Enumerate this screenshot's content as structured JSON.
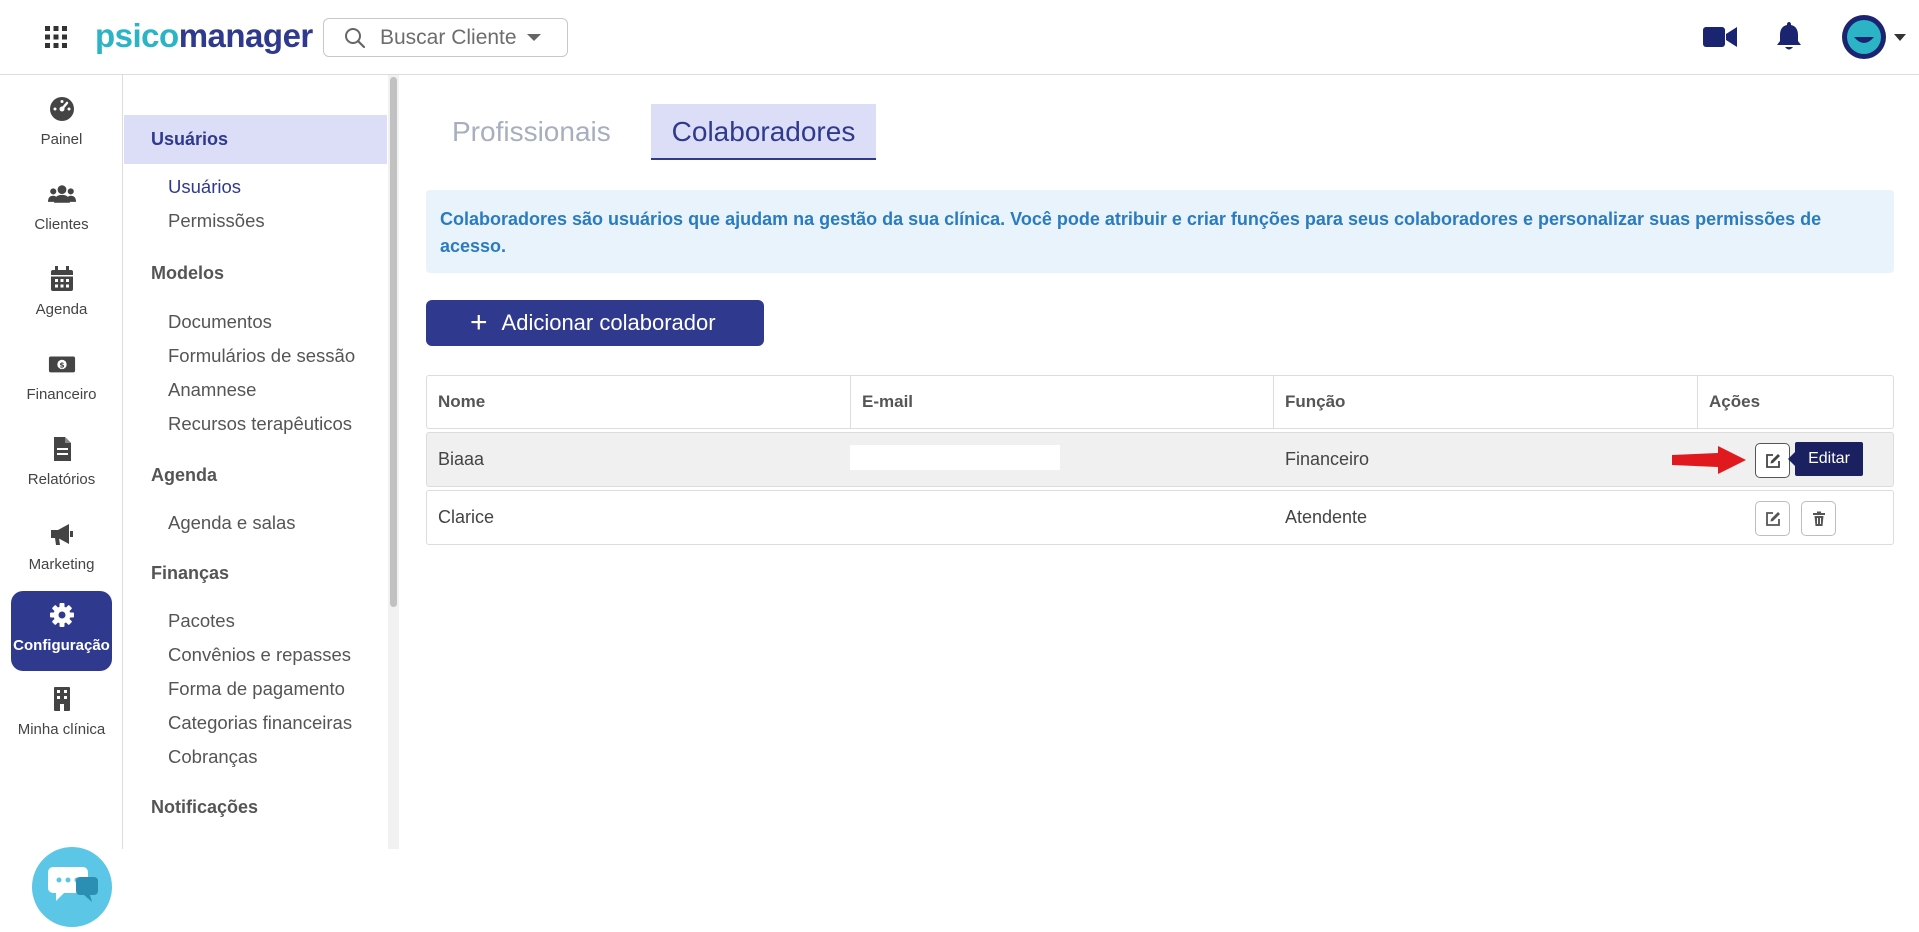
{
  "colors": {
    "primary": "#2f3a8f",
    "accent": "#2bb3c6",
    "info_text": "#2b7bc0",
    "arrow": "#e0191f"
  },
  "topbar": {
    "logo_part1": "psico",
    "logo_part2": "manager",
    "search_placeholder": "Buscar Cliente",
    "icons": [
      "apps-grid-icon",
      "search-icon",
      "video-camera-icon",
      "bell-icon",
      "avatar",
      "chevron-down-icon"
    ]
  },
  "rail": {
    "items": [
      {
        "label": "Painel",
        "icon": "dashboard-gauge-icon"
      },
      {
        "label": "Clientes",
        "icon": "users-icon"
      },
      {
        "label": "Agenda",
        "icon": "calendar-icon"
      },
      {
        "label": "Financeiro",
        "icon": "money-bill-icon"
      },
      {
        "label": "Relatórios",
        "icon": "file-report-icon"
      },
      {
        "label": "Marketing",
        "icon": "megaphone-icon"
      },
      {
        "label": "Configuração",
        "icon": "gear-icon",
        "active": true
      },
      {
        "label": "Minha clínica",
        "icon": "building-icon"
      }
    ],
    "chat_icon": "chat-bubble-icon"
  },
  "settings": {
    "sections": [
      {
        "title": "Usuários",
        "items": [
          "Usuários",
          "Permissões"
        ]
      },
      {
        "title": "Modelos",
        "items": [
          "Documentos",
          "Formulários de sessão",
          "Anamnese",
          "Recursos terapêuticos"
        ]
      },
      {
        "title": "Agenda",
        "items": [
          "Agenda e salas"
        ]
      },
      {
        "title": "Finanças",
        "items": [
          "Pacotes",
          "Convênios e repasses",
          "Forma de pagamento",
          "Categorias financeiras",
          "Cobranças"
        ]
      },
      {
        "title": "Notificações",
        "items": []
      }
    ]
  },
  "main": {
    "tabs": [
      {
        "label": "Profissionais",
        "active": false
      },
      {
        "label": "Colaboradores",
        "active": true
      }
    ],
    "info_text": "Colaboradores são usuários que ajudam na gestão da sua clínica. Você pode atribuir e criar funções para seus colaboradores e personalizar suas permissões de acesso.",
    "add_button": "Adicionar colaborador",
    "table": {
      "columns": [
        "Nome",
        "E-mail",
        "Função",
        "Ações"
      ],
      "rows": [
        {
          "nome": "Biaaa",
          "email": "",
          "funcao": "Financeiro"
        },
        {
          "nome": "Clarice",
          "email": "",
          "funcao": "Atendente"
        }
      ]
    },
    "tooltip": "Editar"
  }
}
